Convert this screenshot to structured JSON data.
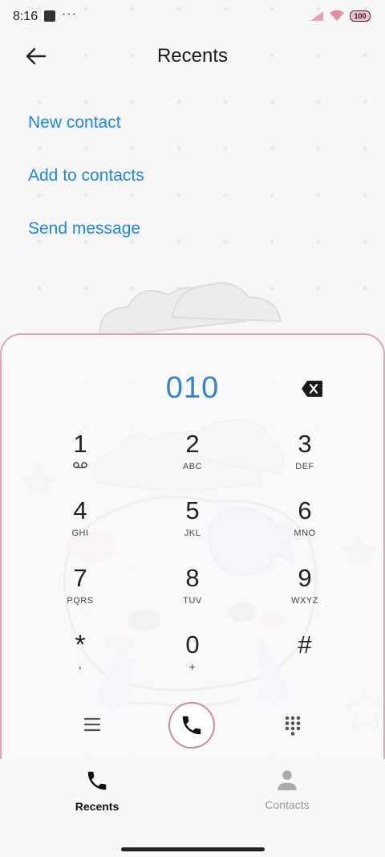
{
  "status_bar": {
    "time": "8:16",
    "dots": "···",
    "battery": "100"
  },
  "header": {
    "title": "Recents"
  },
  "menu": {
    "new_contact": "New contact",
    "add_to_contacts": "Add to contacts",
    "send_message": "Send message"
  },
  "dialer": {
    "number": "010",
    "keys": [
      {
        "digit": "1",
        "letters": ""
      },
      {
        "digit": "2",
        "letters": "ABC"
      },
      {
        "digit": "3",
        "letters": "DEF"
      },
      {
        "digit": "4",
        "letters": "GHI"
      },
      {
        "digit": "5",
        "letters": "JKL"
      },
      {
        "digit": "6",
        "letters": "MNO"
      },
      {
        "digit": "7",
        "letters": "PQRS"
      },
      {
        "digit": "8",
        "letters": "TUV"
      },
      {
        "digit": "9",
        "letters": "WXYZ"
      },
      {
        "digit": "*",
        "letters": ","
      },
      {
        "digit": "0",
        "letters": "+"
      },
      {
        "digit": "#",
        "letters": ""
      }
    ]
  },
  "tabs": {
    "recents": "Recents",
    "contacts": "Contacts"
  },
  "colors": {
    "accent": "#1e88e5",
    "number": "#2f83d9",
    "call_ring": "#cd8a9c",
    "sheet_border": "#d9a9b6"
  }
}
